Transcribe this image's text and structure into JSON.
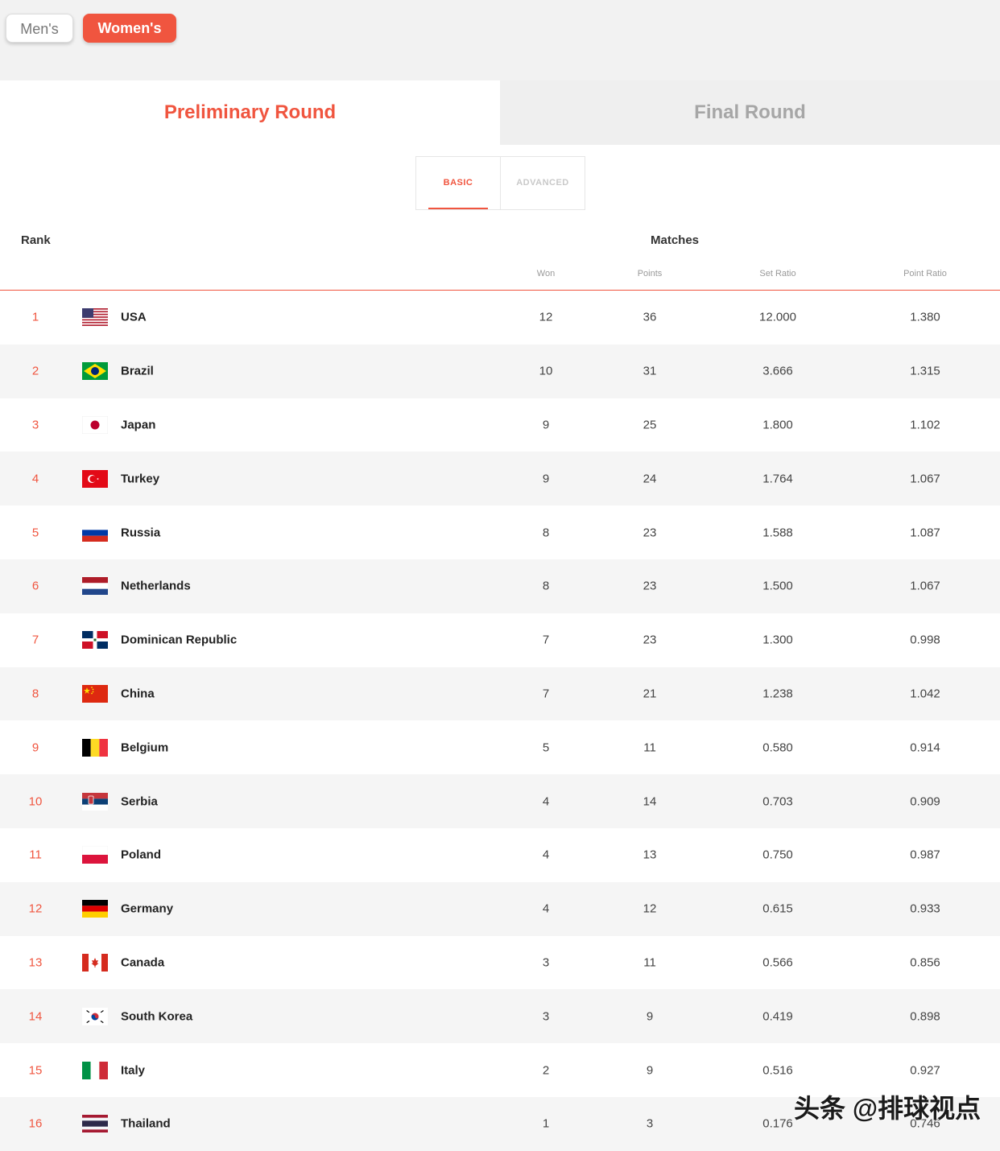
{
  "gender_tabs": {
    "men": "Men's",
    "women": "Women's"
  },
  "round_tabs": {
    "preliminary": "Preliminary Round",
    "final": "Final Round"
  },
  "sub_tabs": {
    "basic": "BASIC",
    "advanced": "ADVANCED"
  },
  "table": {
    "rank_header": "Rank",
    "matches_header": "Matches",
    "columns": {
      "won": "Won",
      "points": "Points",
      "set_ratio": "Set Ratio",
      "point_ratio": "Point Ratio"
    },
    "rows": [
      {
        "rank": "1",
        "country": "USA",
        "flag": "usa-flag",
        "won": "12",
        "points": "36",
        "set_ratio": "12.000",
        "point_ratio": "1.380"
      },
      {
        "rank": "2",
        "country": "Brazil",
        "flag": "brazil-flag",
        "won": "10",
        "points": "31",
        "set_ratio": "3.666",
        "point_ratio": "1.315"
      },
      {
        "rank": "3",
        "country": "Japan",
        "flag": "japan-flag",
        "won": "9",
        "points": "25",
        "set_ratio": "1.800",
        "point_ratio": "1.102"
      },
      {
        "rank": "4",
        "country": "Turkey",
        "flag": "turkey-flag",
        "won": "9",
        "points": "24",
        "set_ratio": "1.764",
        "point_ratio": "1.067"
      },
      {
        "rank": "5",
        "country": "Russia",
        "flag": "russia-flag",
        "won": "8",
        "points": "23",
        "set_ratio": "1.588",
        "point_ratio": "1.087"
      },
      {
        "rank": "6",
        "country": "Netherlands",
        "flag": "netherlands-flag",
        "won": "8",
        "points": "23",
        "set_ratio": "1.500",
        "point_ratio": "1.067"
      },
      {
        "rank": "7",
        "country": "Dominican Republic",
        "flag": "dominican-republic-flag",
        "won": "7",
        "points": "23",
        "set_ratio": "1.300",
        "point_ratio": "0.998"
      },
      {
        "rank": "8",
        "country": "China",
        "flag": "china-flag",
        "won": "7",
        "points": "21",
        "set_ratio": "1.238",
        "point_ratio": "1.042"
      },
      {
        "rank": "9",
        "country": "Belgium",
        "flag": "belgium-flag",
        "won": "5",
        "points": "11",
        "set_ratio": "0.580",
        "point_ratio": "0.914"
      },
      {
        "rank": "10",
        "country": "Serbia",
        "flag": "serbia-flag",
        "won": "4",
        "points": "14",
        "set_ratio": "0.703",
        "point_ratio": "0.909"
      },
      {
        "rank": "11",
        "country": "Poland",
        "flag": "poland-flag",
        "won": "4",
        "points": "13",
        "set_ratio": "0.750",
        "point_ratio": "0.987"
      },
      {
        "rank": "12",
        "country": "Germany",
        "flag": "germany-flag",
        "won": "4",
        "points": "12",
        "set_ratio": "0.615",
        "point_ratio": "0.933"
      },
      {
        "rank": "13",
        "country": "Canada",
        "flag": "canada-flag",
        "won": "3",
        "points": "11",
        "set_ratio": "0.566",
        "point_ratio": "0.856"
      },
      {
        "rank": "14",
        "country": "South Korea",
        "flag": "south-korea-flag",
        "won": "3",
        "points": "9",
        "set_ratio": "0.419",
        "point_ratio": "0.898"
      },
      {
        "rank": "15",
        "country": "Italy",
        "flag": "italy-flag",
        "won": "2",
        "points": "9",
        "set_ratio": "0.516",
        "point_ratio": "0.927"
      },
      {
        "rank": "16",
        "country": "Thailand",
        "flag": "thailand-flag",
        "won": "1",
        "points": "3",
        "set_ratio": "0.176",
        "point_ratio": "0.746"
      }
    ]
  },
  "watermark": "头条 @排球视点",
  "colors": {
    "accent": "#f0553f",
    "alt_row": "#f5f5f5"
  }
}
